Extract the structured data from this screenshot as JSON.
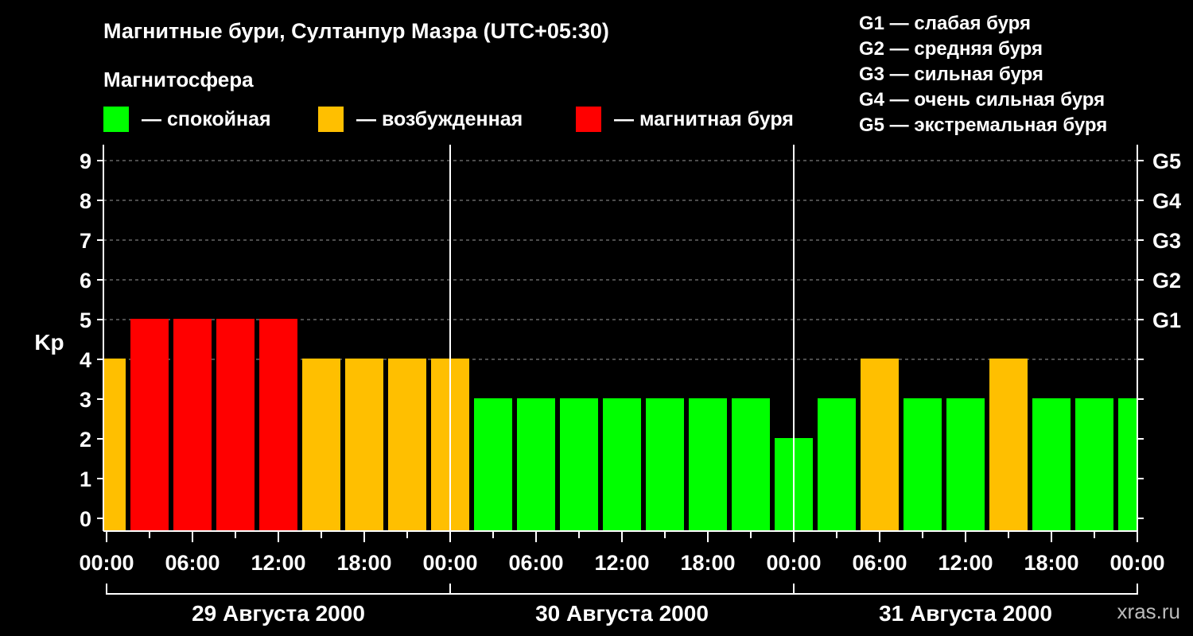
{
  "title": "Магнитные бури, Султанпур Мазра (UTC+05:30)",
  "legend": {
    "heading": "Магнитосфера",
    "items": [
      {
        "label": "— спокойная",
        "color": "#00ff00"
      },
      {
        "label": "— возбужденная",
        "color": "#ffbf00"
      },
      {
        "label": "— магнитная буря",
        "color": "#ff0000"
      }
    ]
  },
  "g_legend": [
    "G1 — слабая буря",
    "G2 — средняя буря",
    "G3 — сильная буря",
    "G4 — очень сильная буря",
    "G5 — экстремальная буря"
  ],
  "watermark": "xras.ru",
  "chart_data": {
    "type": "bar",
    "ylabel": "Kp",
    "ylim": [
      0,
      9
    ],
    "y_ticks": [
      "0",
      "1",
      "2",
      "3",
      "4",
      "5",
      "6",
      "7",
      "8",
      "9"
    ],
    "right_axis_labels": [
      {
        "level": 5,
        "label": "G1"
      },
      {
        "level": 6,
        "label": "G2"
      },
      {
        "level": 7,
        "label": "G3"
      },
      {
        "level": 8,
        "label": "G4"
      },
      {
        "level": 9,
        "label": "G5"
      }
    ],
    "x_tick_labels": [
      "00:00",
      "06:00",
      "12:00",
      "18:00",
      "00:00",
      "06:00",
      "12:00",
      "18:00",
      "00:00",
      "06:00",
      "12:00",
      "18:00",
      "00:00"
    ],
    "days": [
      "29 Августа 2000",
      "30 Августа 2000",
      "31 Августа 2000"
    ],
    "interval_hours": 3,
    "first_bar_offset_hours": -1.5,
    "values": [
      4,
      5,
      5,
      5,
      5,
      4,
      4,
      4,
      4,
      3,
      3,
      3,
      3,
      3,
      3,
      3,
      2,
      3,
      4,
      3,
      3,
      4,
      3,
      3,
      3
    ],
    "colors": {
      "quiet": "#00ff00",
      "active": "#ffbf00",
      "storm": "#ff0000"
    },
    "grid": true
  }
}
